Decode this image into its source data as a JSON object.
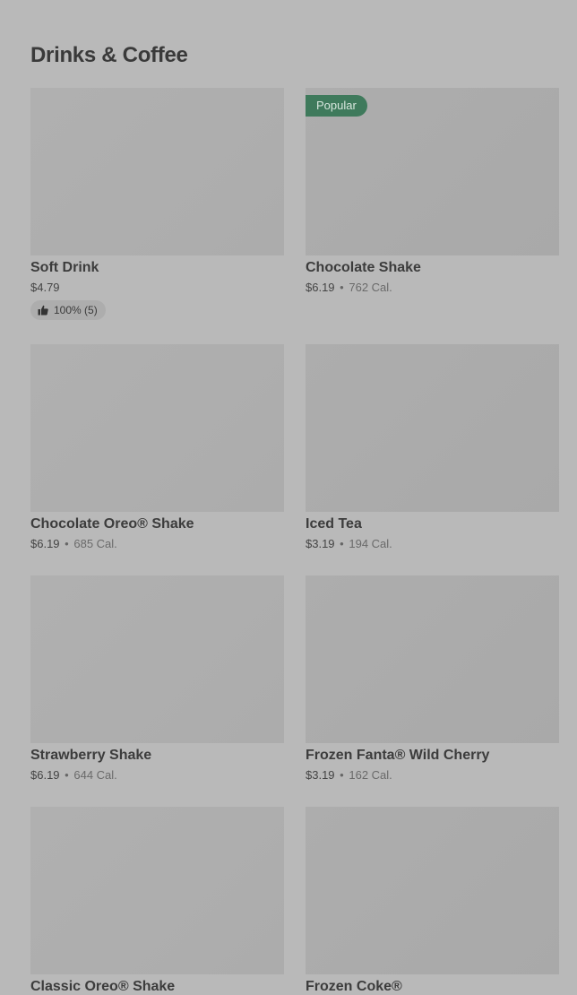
{
  "section": {
    "title": "Drinks & Coffee"
  },
  "items": [
    {
      "name": "Soft Drink",
      "price": "$4.79",
      "calories": "",
      "badge": "",
      "rating": "100% (5)"
    },
    {
      "name": "Chocolate Shake",
      "price": "$6.19",
      "calories": "762 Cal.",
      "badge": "Popular",
      "rating": ""
    },
    {
      "name": "Chocolate Oreo® Shake",
      "price": "$6.19",
      "calories": "685 Cal.",
      "badge": "",
      "rating": ""
    },
    {
      "name": "Iced Tea",
      "price": "$3.19",
      "calories": "194 Cal.",
      "badge": "",
      "rating": ""
    },
    {
      "name": "Strawberry Shake",
      "price": "$6.19",
      "calories": "644 Cal.",
      "badge": "",
      "rating": ""
    },
    {
      "name": "Frozen Fanta® Wild Cherry",
      "price": "$3.19",
      "calories": "162 Cal.",
      "badge": "",
      "rating": ""
    },
    {
      "name": "Classic Oreo® Shake",
      "price": "",
      "calories": "",
      "badge": "",
      "rating": ""
    },
    {
      "name": "Frozen Coke®",
      "price": "",
      "calories": "",
      "badge": "",
      "rating": ""
    }
  ],
  "separator": "•",
  "icons": {
    "rating": "thumbs-up-icon"
  },
  "colors": {
    "background": "#b9b9b9",
    "badge": "#3f7a5c"
  }
}
